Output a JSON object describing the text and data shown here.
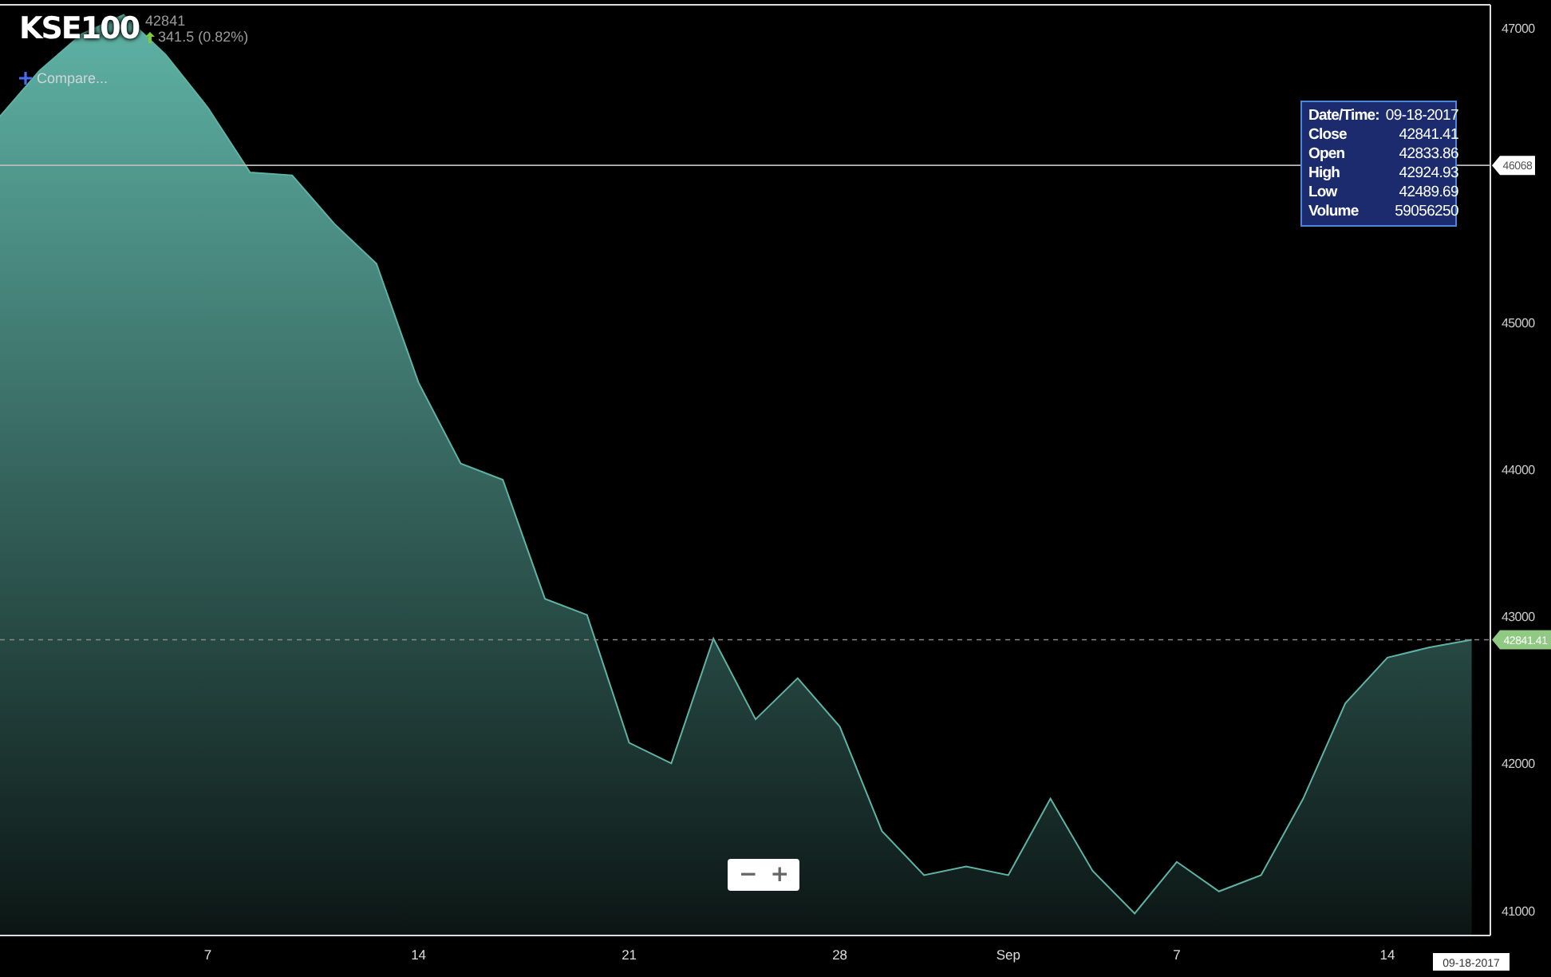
{
  "header": {
    "symbol": "KSE100",
    "price": "42841",
    "change": "341.5 (0.82%)",
    "compare_label": "Compare..."
  },
  "chart": {
    "chart_data": {
      "type": "area",
      "categories": [
        null,
        null,
        null,
        null,
        null,
        "7",
        null,
        null,
        null,
        null,
        "14",
        null,
        null,
        null,
        null,
        "21",
        null,
        null,
        null,
        null,
        "28",
        null,
        null,
        null,
        "Sep",
        null,
        null,
        null,
        "7",
        null,
        null,
        null,
        null,
        "14",
        null,
        null
      ],
      "series": [
        {
          "color": "#5fb3a6",
          "values": [
            46380,
            46710,
            46960,
            47090,
            46820,
            46460,
            46020,
            46000,
            45670,
            45400,
            44590,
            44040,
            43930,
            43120,
            43010,
            42140,
            42000,
            42850,
            42300,
            42580,
            42250,
            41540,
            41240,
            41300,
            41240,
            41760,
            41270,
            40980,
            41330,
            41130,
            41240,
            41760,
            42410,
            42720,
            42790,
            42841
          ]
        }
      ],
      "ylim": [
        40830,
        47160
      ],
      "yticks": [
        41000,
        42000,
        43000,
        44000,
        45000,
        47000
      ],
      "ref_lines": [
        {
          "axis": "y",
          "value": 46068,
          "label": "46068"
        },
        {
          "axis": "y",
          "value": 42841.41,
          "label": "42841.41"
        }
      ]
    },
    "date_label": "09-18-2017"
  },
  "tooltip": {
    "rows": [
      {
        "label": "Date/Time:",
        "value": "09-18-2017"
      },
      {
        "label": "Close",
        "value": "42841.41"
      },
      {
        "label": "Open",
        "value": "42833.86"
      },
      {
        "label": "High",
        "value": "42924.93"
      },
      {
        "label": "Low",
        "value": "42489.69"
      },
      {
        "label": "Volume",
        "value": "59056250"
      }
    ]
  },
  "zoom_buttons": [
    "−",
    "+"
  ]
}
